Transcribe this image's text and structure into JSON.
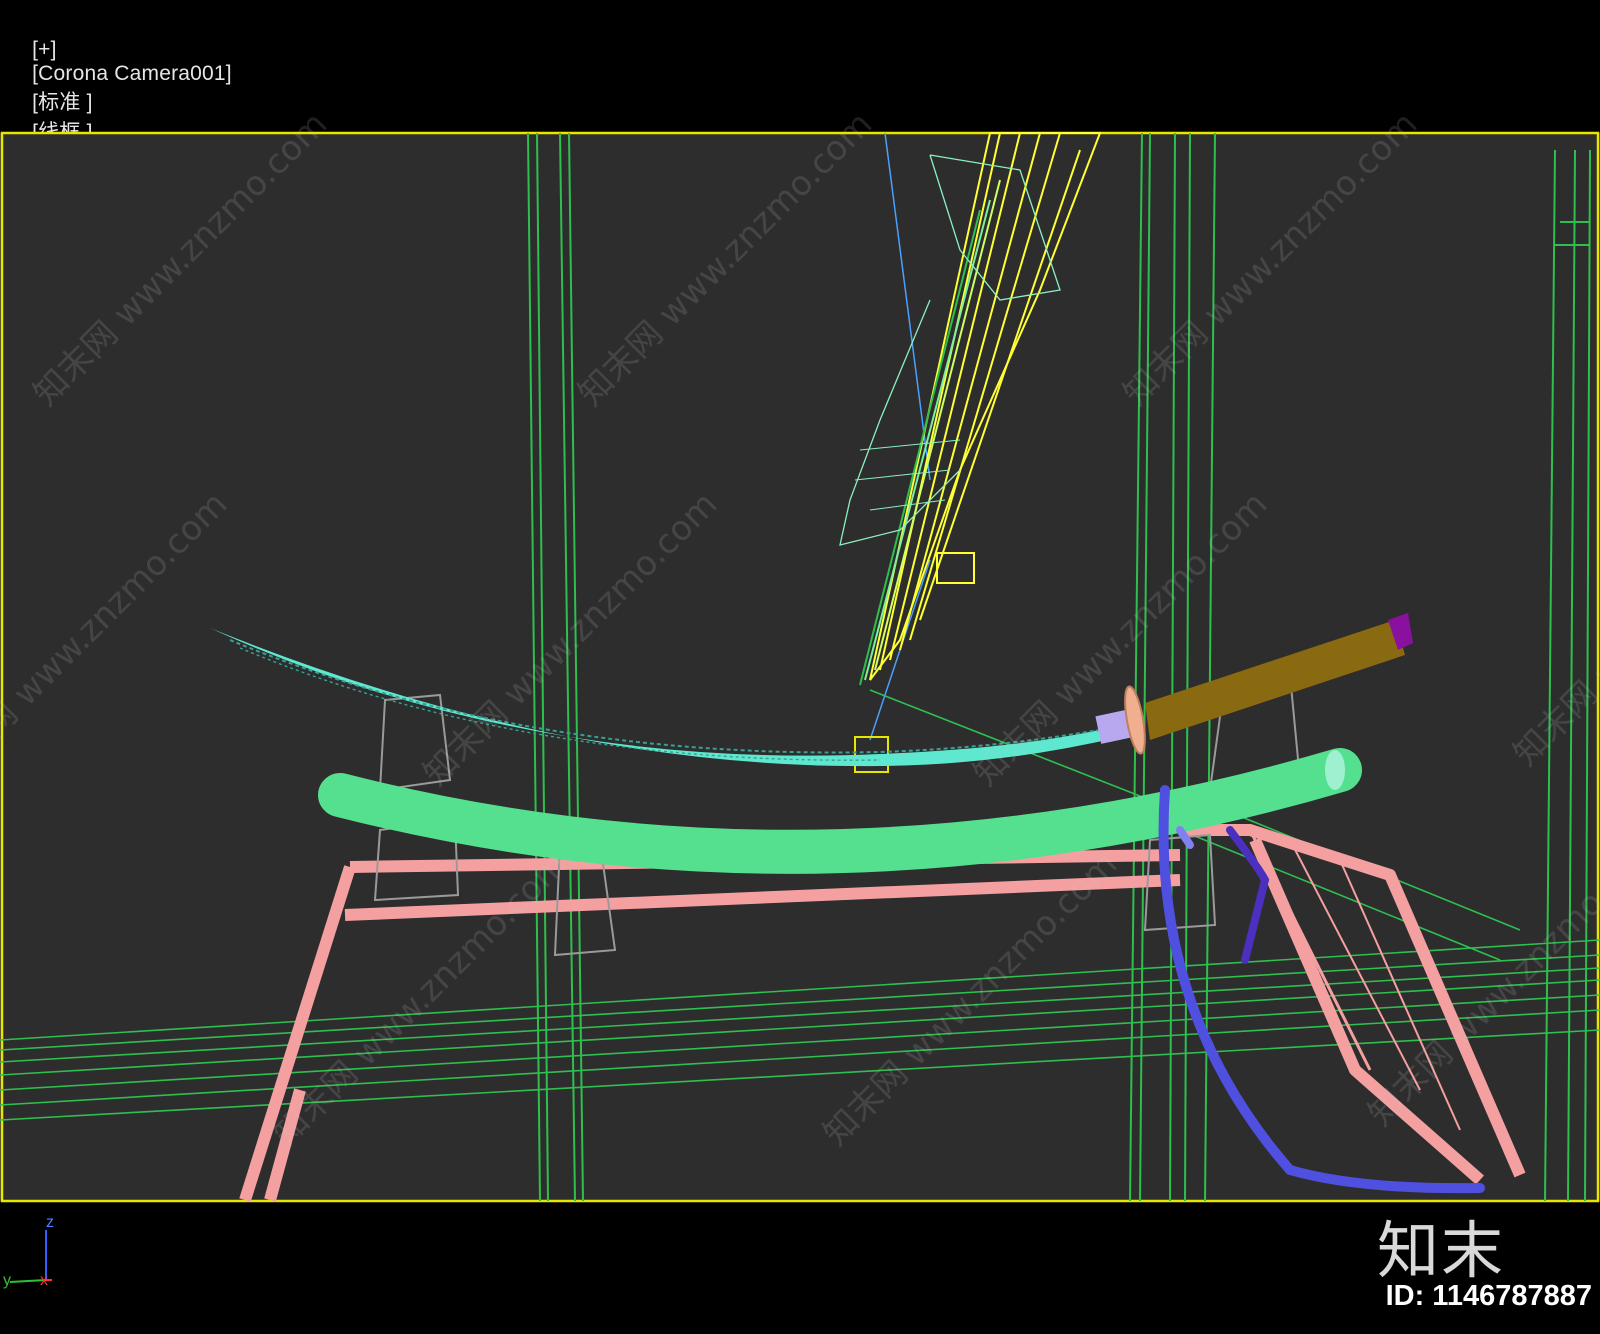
{
  "viewport": {
    "label_parts": [
      "[+]",
      "[Corona Camera001]",
      "[标准 ]",
      "[线框 ]"
    ]
  },
  "axes": {
    "z": "z",
    "y": "y",
    "x": "x"
  },
  "watermark": {
    "tile_text": "知末网 www.znzmo.com",
    "brand": "知末",
    "id_text": "ID: 1146787887"
  },
  "colors": {
    "frame_border": "#e6e600",
    "viewport_bg": "#2d2d2d",
    "blade": "#5fe8d0",
    "scabbard": "#55e08f",
    "handle": "#8a6a10",
    "stand": "#f4a0a0",
    "sageo_cord": "#5050e0",
    "grid_lines": "#2fbf4f",
    "light_yellow": "#ffff33"
  }
}
